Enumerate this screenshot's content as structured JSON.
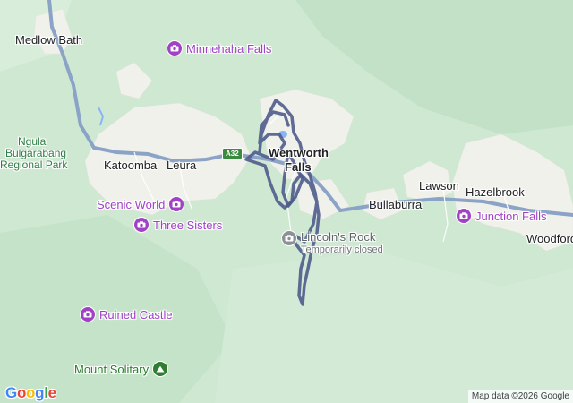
{
  "map": {
    "route_color": "#4f5b8c",
    "road_color": "#8aa3c6",
    "urban_color": "#f2f2ee",
    "forest_color": "#bfe0c3",
    "road_shield": "A32",
    "towns": [
      {
        "name": "Medlow Bath",
        "bold": false
      },
      {
        "name": "Katoomba",
        "bold": false
      },
      {
        "name": "Leura",
        "bold": false
      },
      {
        "name": "Wentworth",
        "bold": true
      },
      {
        "name": "Falls",
        "bold": true
      },
      {
        "name": "Bullaburra",
        "bold": false
      },
      {
        "name": "Lawson",
        "bold": false
      },
      {
        "name": "Hazelbrook",
        "bold": false
      },
      {
        "name": "Woodford",
        "bold": false
      }
    ],
    "park_label": [
      "Ngula",
      "Bulgarabang",
      "Regional Park"
    ],
    "pois": [
      {
        "name": "Minnehaha Falls",
        "type": "attraction",
        "color": "#a142c6"
      },
      {
        "name": "Scenic World",
        "type": "attraction",
        "color": "#a142c6"
      },
      {
        "name": "Three Sisters",
        "type": "attraction",
        "color": "#a142c6"
      },
      {
        "name": "Junction Falls",
        "type": "attraction",
        "color": "#a142c6"
      },
      {
        "name": "Ruined Castle",
        "type": "attraction",
        "color": "#a142c6"
      },
      {
        "name": "Lincoln's Rock",
        "type": "attraction-closed",
        "color": "#70757a",
        "status": "Temporarily closed"
      },
      {
        "name": "Mount Solitary",
        "type": "mountain",
        "color": "#2e7d32"
      }
    ],
    "icons": {
      "attraction": "camera-icon",
      "mountain": "mountain-icon"
    }
  },
  "footer": {
    "logo": "Google",
    "logo_colors": [
      "#4285F4",
      "#EA4335",
      "#FBBC05",
      "#4285F4",
      "#34A853",
      "#EA4335"
    ],
    "credit": "Map data ©2026 Google"
  }
}
